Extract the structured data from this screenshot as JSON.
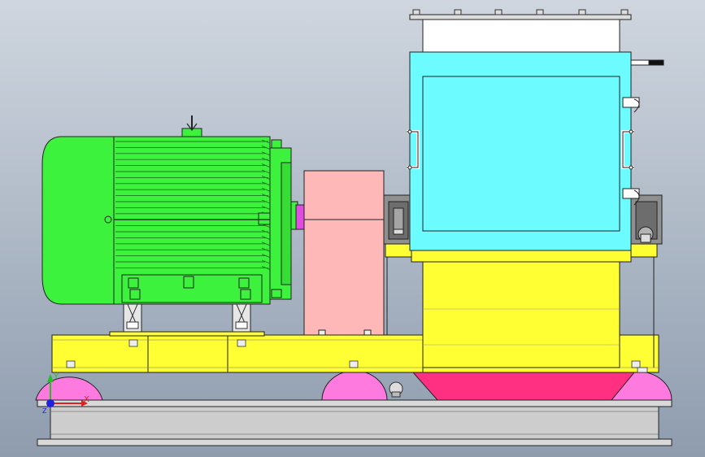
{
  "viewport": {
    "background_top": "#cfd6df",
    "background_bottom": "#8e9cae"
  },
  "colors": {
    "motor": "#3df23d",
    "motor_dark": "#24c224",
    "coupling_guard": "#ffb8b8",
    "mill_housing": "#6cfcff",
    "mill_frame_yellow": "#ffff33",
    "hopper": "#ffffff",
    "feet_pink": "#ff7adf",
    "skid_red": "#ff2f82",
    "base_beam": "#d9d9d9",
    "bearing_gray": "#909090",
    "outline": "#222222"
  },
  "triad": {
    "x_label": "X",
    "y_label": "Y",
    "z_label": "Z",
    "x_color": "#e02020",
    "y_color": "#20c020",
    "z_color": "#2020e0"
  },
  "parts": [
    {
      "name": "electric-motor",
      "icon": "motor"
    },
    {
      "name": "motor-terminal-box",
      "icon": "terminal-box"
    },
    {
      "name": "lifting-eye",
      "icon": "lifting-eye"
    },
    {
      "name": "coupling-guard",
      "icon": "guard"
    },
    {
      "name": "hammer-mill-housing",
      "icon": "housing"
    },
    {
      "name": "inspection-door",
      "icon": "door"
    },
    {
      "name": "feed-hopper",
      "icon": "hopper"
    },
    {
      "name": "bearing-housing-left",
      "icon": "bearing"
    },
    {
      "name": "bearing-housing-right",
      "icon": "bearing"
    },
    {
      "name": "mill-base-frame",
      "icon": "frame"
    },
    {
      "name": "motor-base-plate",
      "icon": "plate"
    },
    {
      "name": "vibration-isolator-feet",
      "icon": "isolator"
    },
    {
      "name": "discharge-skid",
      "icon": "skid"
    },
    {
      "name": "steel-i-beam-base",
      "icon": "beam"
    }
  ]
}
